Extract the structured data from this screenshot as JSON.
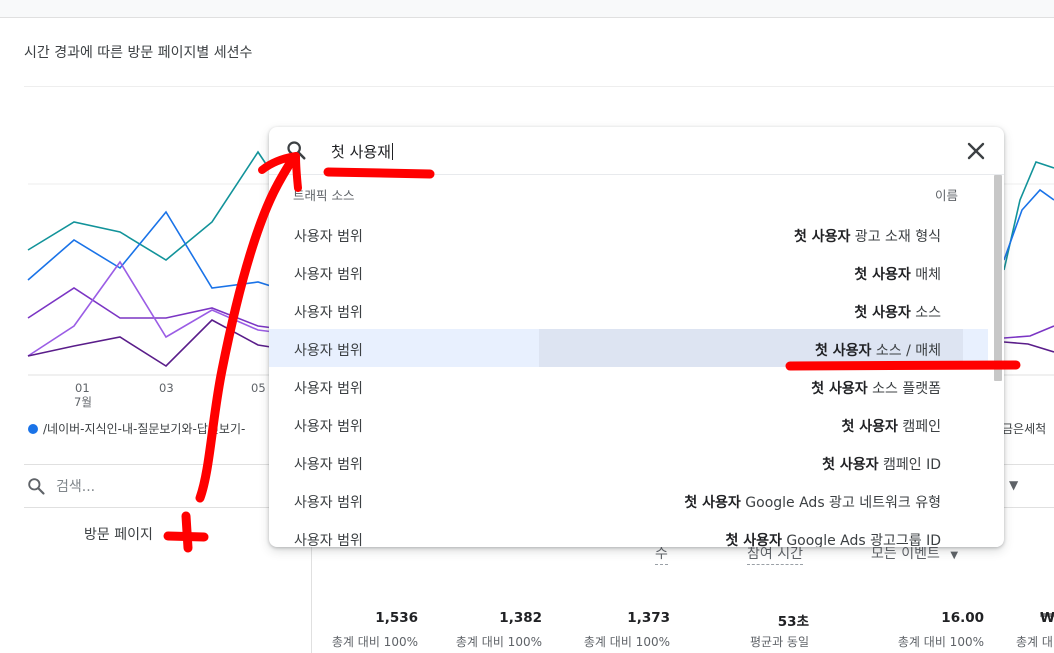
{
  "card": {
    "title": "시간 경과에 따른 방문 페이지별 세션수"
  },
  "chart": {
    "x_ticks": [
      "01",
      "03",
      "05"
    ],
    "x_month": "7월",
    "legend_left": "/네이버-지식인-내-질문보기와-답변보기-",
    "legend_right": "금은세척",
    "series_colors": [
      "#1a73e8",
      "#12939a",
      "#7b35c4",
      "#5a1d8a"
    ]
  },
  "table": {
    "search_placeholder": "검색...",
    "dimension_header": "방문 페이지",
    "metric_headers": [
      "수",
      "참여 시간",
      "모든 이벤트"
    ],
    "totals": [
      {
        "value": "1,536",
        "sub": "총계 대비 100%"
      },
      {
        "value": "1,382",
        "sub": "총계 대비 100%"
      },
      {
        "value": "1,373",
        "sub": "총계 대비 100%"
      },
      {
        "value": "53초",
        "sub": "평균과 동일"
      },
      {
        "value": "16.00",
        "sub": "총계 대비 100%"
      },
      {
        "value": "₩",
        "sub": "총계 대"
      }
    ]
  },
  "dropdown": {
    "query": "첫 사용재",
    "col_left": "트래픽 소스",
    "col_right": "이름",
    "items": [
      {
        "category": "사용자 범위",
        "bold": "첫 사용자",
        "rest": " 광고 소재 형식"
      },
      {
        "category": "사용자 범위",
        "bold": "첫 사용자",
        "rest": " 매체"
      },
      {
        "category": "사용자 범위",
        "bold": "첫 사용자",
        "rest": " 소스"
      },
      {
        "category": "사용자 범위",
        "bold": "첫 사용자",
        "rest": " 소스 / 매체",
        "highlighted": true
      },
      {
        "category": "사용자 범위",
        "bold": "첫 사용자",
        "rest": " 소스 플랫폼"
      },
      {
        "category": "사용자 범위",
        "bold": "첫 사용자",
        "rest": " 캠페인"
      },
      {
        "category": "사용자 범위",
        "bold": "첫 사용자",
        "rest": " 캠페인 ID"
      },
      {
        "category": "사용자 범위",
        "bold": "첫 사용자",
        "rest": " Google Ads 광고 네트워크 유형"
      },
      {
        "category": "사용자 범위",
        "bold": "첫 사용자",
        "rest": " Google Ads 광고그룹 ID"
      }
    ]
  },
  "colors": {
    "annotation": "#ff0000",
    "highlight": "#e8f0fe"
  }
}
